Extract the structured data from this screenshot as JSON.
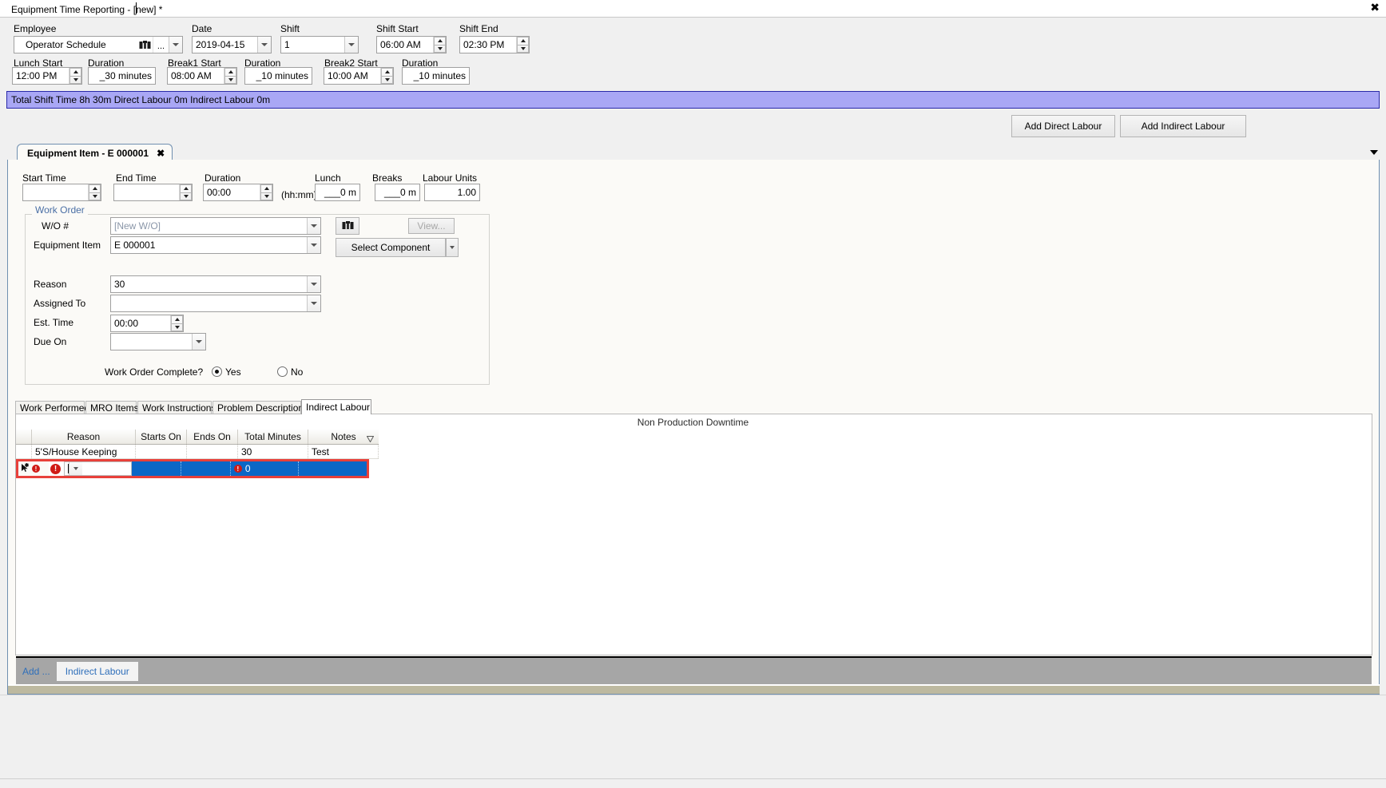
{
  "window": {
    "tab_title": "Equipment Time Reporting - [new] *",
    "close_icon": "close-icon",
    "close_glyph": "✖"
  },
  "header": {
    "employee_label": "Employee",
    "employee_value": "Operator Schedule",
    "employee_search_icon": "binoculars-icon",
    "employee_ellipsis": "...",
    "date_label": "Date",
    "date_value": "2019-04-15",
    "shift_label": "Shift",
    "shift_value": "1",
    "shift_start_label": "Shift Start",
    "shift_start_value": "06:00 AM",
    "shift_end_label": "Shift End",
    "shift_end_value": "02:30 PM",
    "lunch_start_label": "Lunch Start",
    "lunch_start_value": "12:00 PM",
    "lunch_duration_label": "Duration",
    "lunch_duration_value": "_30 minutes",
    "break1_label": "Break1 Start",
    "break1_value": "08:00 AM",
    "break1_duration_label": "Duration",
    "break1_duration_value": "_10 minutes",
    "break2_label": "Break2 Start",
    "break2_value": "10:00 AM",
    "break2_duration_label": "Duration",
    "break2_duration_value": "_10 minutes"
  },
  "summary_bar": {
    "text": "Total Shift Time 8h 30m  Direct Labour 0m  Indirect Labour 0m"
  },
  "actions": {
    "add_direct_labour": "Add Direct Labour",
    "add_indirect_labour": "Add Indirect Labour"
  },
  "item_tab": {
    "label": "Equipment Item - E 000001",
    "close_glyph": "✖"
  },
  "time_row": {
    "start_time_label": "Start Time",
    "start_time_value": "",
    "end_time_label": "End Time",
    "end_time_value": "",
    "duration_label": "Duration",
    "duration_value": "00:00",
    "duration_hint": "(hh:mm)",
    "lunch_label": "Lunch",
    "lunch_value": "___0 m",
    "breaks_label": "Breaks",
    "breaks_value": "___0 m",
    "labour_units_label": "Labour Units",
    "labour_units_value": "1.00"
  },
  "work_order": {
    "group_title": "Work Order",
    "wo_label": "W/O #",
    "wo_value": "[New W/O]",
    "search_icon": "binoculars-icon",
    "view_button": "View...",
    "equipment_item_label": "Equipment Item",
    "equipment_item_value": "E 000001",
    "select_component_button": "Select Component",
    "reason_label": "Reason",
    "reason_value": "30",
    "assigned_to_label": "Assigned To",
    "assigned_to_value": "",
    "est_time_label": "Est. Time",
    "est_time_value": "00:00",
    "due_on_label": "Due On",
    "due_on_value": "",
    "complete_label": "Work Order Complete?",
    "yes_label": "Yes",
    "no_label": "No",
    "complete_selected": "Yes"
  },
  "lower_tabs": [
    {
      "label": "Work Performed",
      "active": false
    },
    {
      "label": "MRO Items",
      "active": false
    },
    {
      "label": "Work Instructions",
      "active": false
    },
    {
      "label": "Problem Description",
      "active": false
    },
    {
      "label": "Indirect Labour",
      "active": true
    }
  ],
  "grid": {
    "caption": "Non Production Downtime",
    "columns": [
      "Reason",
      "Starts On",
      "Ends On",
      "Total Minutes",
      "Notes"
    ],
    "sort_icon": "sort-descending-icon",
    "rows": [
      {
        "reason": "5'S/House Keeping",
        "starts_on": "",
        "ends_on": "",
        "total_minutes": "30",
        "notes": "Test"
      }
    ],
    "new_row": {
      "row_marker_icon": "new-row-asterisk-icon",
      "row_error_icon": "error-icon",
      "cell_error_icon": "error-icon",
      "reason": "",
      "starts_on": "",
      "ends_on": "",
      "total_minutes": "0",
      "notes": ""
    }
  },
  "footer": {
    "add_label": "Add ...",
    "indirect_labour_button": "Indirect Labour"
  }
}
